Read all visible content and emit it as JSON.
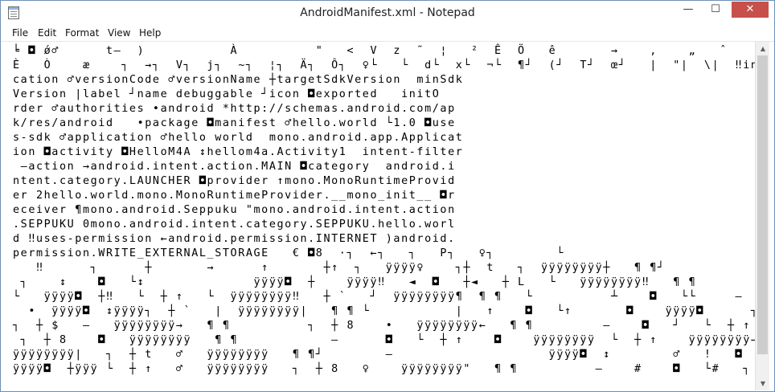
{
  "window": {
    "title": "AndroidManifest.xml - Notepad",
    "controls": {
      "minimize": "—",
      "maximize": "☐",
      "close": "✕"
    }
  },
  "menu": [
    "File",
    "Edit",
    "Format",
    "View",
    "Help"
  ],
  "document": {
    "lines": [
      "╘ ◘ ǿ♂      t‒  )           À          \"   <  V  z  ˜  ¦   ²  Ê  Ö   ê       →    ,    „   ˆ    š   ®",
      "È   Ò    æ    ┐  →┐  V┐  j┐  ~┐  ¦┐  Ä┐  Ô┐  ♀└   └  d└  x└  ¬└  ¶┘  (┘  T┘  œ┘   |  \"|  \\|  ‼installLo",
      "cation ♂versionCode ♂versionName ┼targetSdkVersion  minSdk",
      "Version |label ┘name debuggable ┘icon ◘exported   initO",
      "rder ♂authorities •android *http://schemas.android.com/ap",
      "k/res/android   •package ◘manifest ♂hello.world └1.0 ◘use",
      "s-sdk ♂application ♂hello world  mono.android.app.Applicat",
      "ion ◘activity ◘HelloM4A ↕hellom4a.Activity1  intent-filter",
      " ‒action →android.intent.action.MAIN ◘category  android.i",
      "ntent.category.LAUNCHER ◘provider ↑mono.MonoRuntimeProvid",
      "er 2hello.world.mono.MonoRuntimeProvider.__mono_init__ ◘r",
      "eceiver ¶mono.android.Seppuku \"mono.android.intent.action",
      ".SEPPUKU 0mono.android.intent.category.SEPPUKU.hello.worl",
      "d ‼uses-permission ←android.permission.INTERNET )android.",
      "permission.WRITE_EXTERNAL_STORAGE   € ◘8  ·┐  ←┐   ┐   P┐   ♀┐        └",
      "   ‼      ┐      ┼       →      ↑       ┼↑  ┐   ÿÿÿÿ♀    ┐┼  t   ┐  ÿÿÿÿÿÿÿÿ┼   ¶ ¶┘            ÿÿÿÿ◘  ┼",
      " ┐    ↕    ◘   └↕              ÿÿÿÿ◘  ┼    ÿÿÿÿ‼   ◄  ◘   ┼◄   ┼ L   └   ÿÿÿÿÿÿÿÿ‼   ¶ ¶          ┘   ÿÿÿÿ◘  ┼◘",
      "└   ÿÿÿÿ◘  ┼‼   └  ┼ ↑   └  ÿÿÿÿÿÿÿÿ‼   ┼ `   ┘  ÿÿÿÿÿÿÿÿ¶  ¶ ¶   └          ┴    ◘   └└     ‒  ┬    ◘  └┼",
      "  •  ÿÿÿÿ◘  ↕ÿÿÿÿ┐  ┼ `   |  ÿÿÿÿÿÿÿÿ|   ¶ ¶ └           |   ↑    ◘   └↑       ◘    ÿÿÿÿ◘      ┐  ┼  ◘   └┼",
      "┐  ┼ $   ‒   ÿÿÿÿÿÿÿÿ→   ¶ ¶          ┐  ┼ 8    •   ÿÿÿÿÿÿÿÿ←   ¶ ¶         ‒    ◘   ┘   └  ┼ ↑   •  ÿÿÿÿÿÿÿÿ←",
      " ┐  ┼ 8    ◘   ÿÿÿÿÿÿÿÿ   ¶ ¶            ‒      ◘   └  ┼ ↑    ◘    ÿÿÿÿÿÿÿÿ  └  ┼ ↑    ÿÿÿÿÿÿÿÿ→  └  ┼ ↑",
      "ÿÿÿÿÿÿÿÿ|   ┐  ┼ t   ♂   ÿÿÿÿÿÿÿÿ   ¶ ¶┘        ‒                    ÿÿÿÿ◘  ↕        ♂   !   ◘   └!",
      "ÿÿÿÿ◘  ┼ÿÿÿ └  ┼ ↑   ♂   ÿÿÿÿÿÿÿÿ   ┐  ┼ 8   ♀    ÿÿÿÿÿÿÿÿ\"   ¶ ¶          ‒    #    ◘   └#   ┐  ┼ $      ÿÿÿÿÿÿÿÿ→"
    ]
  },
  "scrollbar": {
    "up_arrow": "▲",
    "down_arrow": "▼"
  }
}
